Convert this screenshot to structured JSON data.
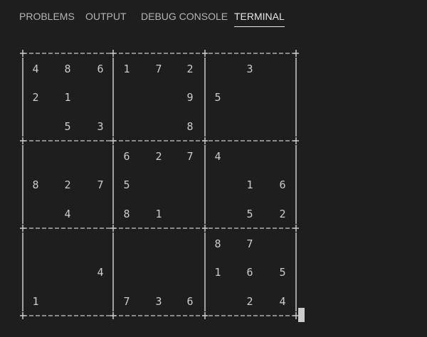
{
  "tabs": [
    {
      "label": "PROBLEMS"
    },
    {
      "label": "OUTPUT"
    },
    {
      "label": "DEBUG CONSOLE"
    },
    {
      "label": "TERMINAL",
      "active": true
    }
  ],
  "terminal": {
    "rows": [
      [
        "4",
        "8",
        "6",
        "1",
        "7",
        "2",
        "",
        "3",
        ""
      ],
      [
        "2",
        "1",
        "",
        "",
        "",
        "9",
        "5",
        "",
        ""
      ],
      [
        "",
        "5",
        "3",
        "",
        "",
        "8",
        "",
        "",
        ""
      ],
      [
        "",
        "",
        "",
        "6",
        "2",
        "7",
        "4",
        "",
        ""
      ],
      [
        "8",
        "2",
        "7",
        "5",
        "",
        "",
        "",
        "1",
        "6"
      ],
      [
        "",
        "4",
        "",
        "8",
        "1",
        "",
        "",
        "5",
        "2"
      ],
      [
        "",
        "",
        "",
        "",
        "",
        "",
        "8",
        "7",
        ""
      ],
      [
        "",
        "",
        "4",
        "",
        "",
        "",
        "1",
        "6",
        "5"
      ],
      [
        "1",
        "",
        "",
        "7",
        "3",
        "6",
        "",
        "2",
        "4"
      ]
    ]
  },
  "colors": {
    "background": "#1e1e1e",
    "text": "#cccccc",
    "active_tab": "#e7e7e7",
    "inactive_tab": "#b4b4b4"
  }
}
